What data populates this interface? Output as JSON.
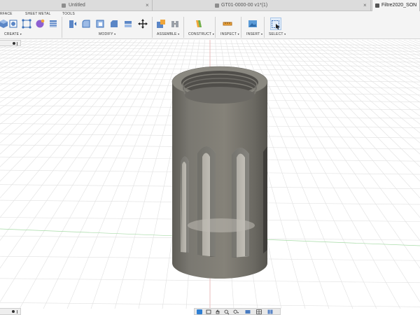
{
  "tabs": [
    {
      "label": "Untitled",
      "close": "×"
    },
    {
      "label": "GT01-0000-00 v1*(1)",
      "close": "×"
    },
    {
      "label": "Filtre2020_SON",
      "close": "×"
    }
  ],
  "toolbar": {
    "categories": [
      "RFACE",
      "SHEET METAL",
      "TOOLS"
    ],
    "groups": {
      "create": "CREATE",
      "modify": "MODIFY",
      "assemble": "ASSEMBLE",
      "construct": "CONSTRUCT",
      "inspect": "INSPECT",
      "insert": "INSERT",
      "select": "SELECT"
    },
    "caret": "▾"
  },
  "colors": {
    "accent": "#2f7fd3",
    "model": "#7c7a73",
    "grid": "#e3e3e3",
    "axis_red": "#e07070",
    "axis_green": "#79c879"
  },
  "icons": [
    "cube-icon",
    "sketch-icon",
    "form-icon",
    "extrude-icon",
    "press-pull-icon",
    "fillet-icon",
    "shell-icon",
    "split-icon",
    "move-icon",
    "joint-icon",
    "plane-icon",
    "measure-icon",
    "image-icon",
    "select-icon",
    "orbit-icon",
    "pan-icon",
    "zoom-icon",
    "display-icon",
    "grid-icon"
  ]
}
